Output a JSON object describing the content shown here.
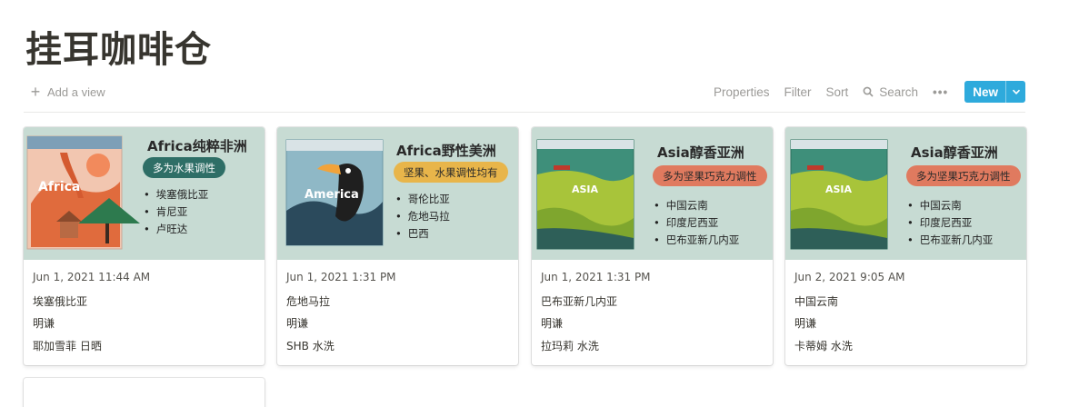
{
  "page": {
    "title": "挂耳咖啡仓"
  },
  "toolbar": {
    "add_view": "Add a view",
    "properties": "Properties",
    "filter": "Filter",
    "sort": "Sort",
    "search": "Search",
    "more": "•••",
    "new": "New"
  },
  "cards": [
    {
      "cover": {
        "title": "Africa纯粹非洲",
        "tag": "多为水果调性",
        "tag_bg": "#2e6e66",
        "tag_fg": "#ffffff",
        "bag_label": "Africa",
        "items": [
          "埃塞俄比亚",
          "肯尼亚",
          "卢旺达"
        ]
      },
      "date": "Jun 1, 2021 11:44 AM",
      "origin": "埃塞俄比亚",
      "roaster": "明谦",
      "process": "耶加雪菲 日晒"
    },
    {
      "cover": {
        "title": "Africa野性美洲",
        "tag": "坚果、水果调性均有",
        "tag_bg": "#e8b54a",
        "tag_fg": "#2a2a2a",
        "bag_label": "America",
        "items": [
          "哥伦比亚",
          "危地马拉",
          "巴西"
        ]
      },
      "date": "Jun 1, 2021 1:31 PM",
      "origin": "危地马拉",
      "roaster": "明谦",
      "process": "SHB 水洗"
    },
    {
      "cover": {
        "title": "Asia醇香亚洲",
        "tag": "多为坚果巧克力调性",
        "tag_bg": "#e07a5f",
        "tag_fg": "#2a2a2a",
        "bag_label": "ASIA",
        "items": [
          "中国云南",
          "印度尼西亚",
          "巴布亚新几内亚"
        ]
      },
      "date": "Jun 1, 2021 1:31 PM",
      "origin": "巴布亚新几内亚",
      "roaster": "明谦",
      "process": "拉玛莉 水洗"
    },
    {
      "cover": {
        "title": "Asia醇香亚洲",
        "tag": "多为坚果巧克力调性",
        "tag_bg": "#e07a5f",
        "tag_fg": "#2a2a2a",
        "bag_label": "ASIA",
        "items": [
          "中国云南",
          "印度尼西亚",
          "巴布亚新几内亚"
        ]
      },
      "date": "Jun 2, 2021 9:05 AM",
      "origin": "中国云南",
      "roaster": "明谦",
      "process": "卡蒂姆 水洗"
    }
  ]
}
